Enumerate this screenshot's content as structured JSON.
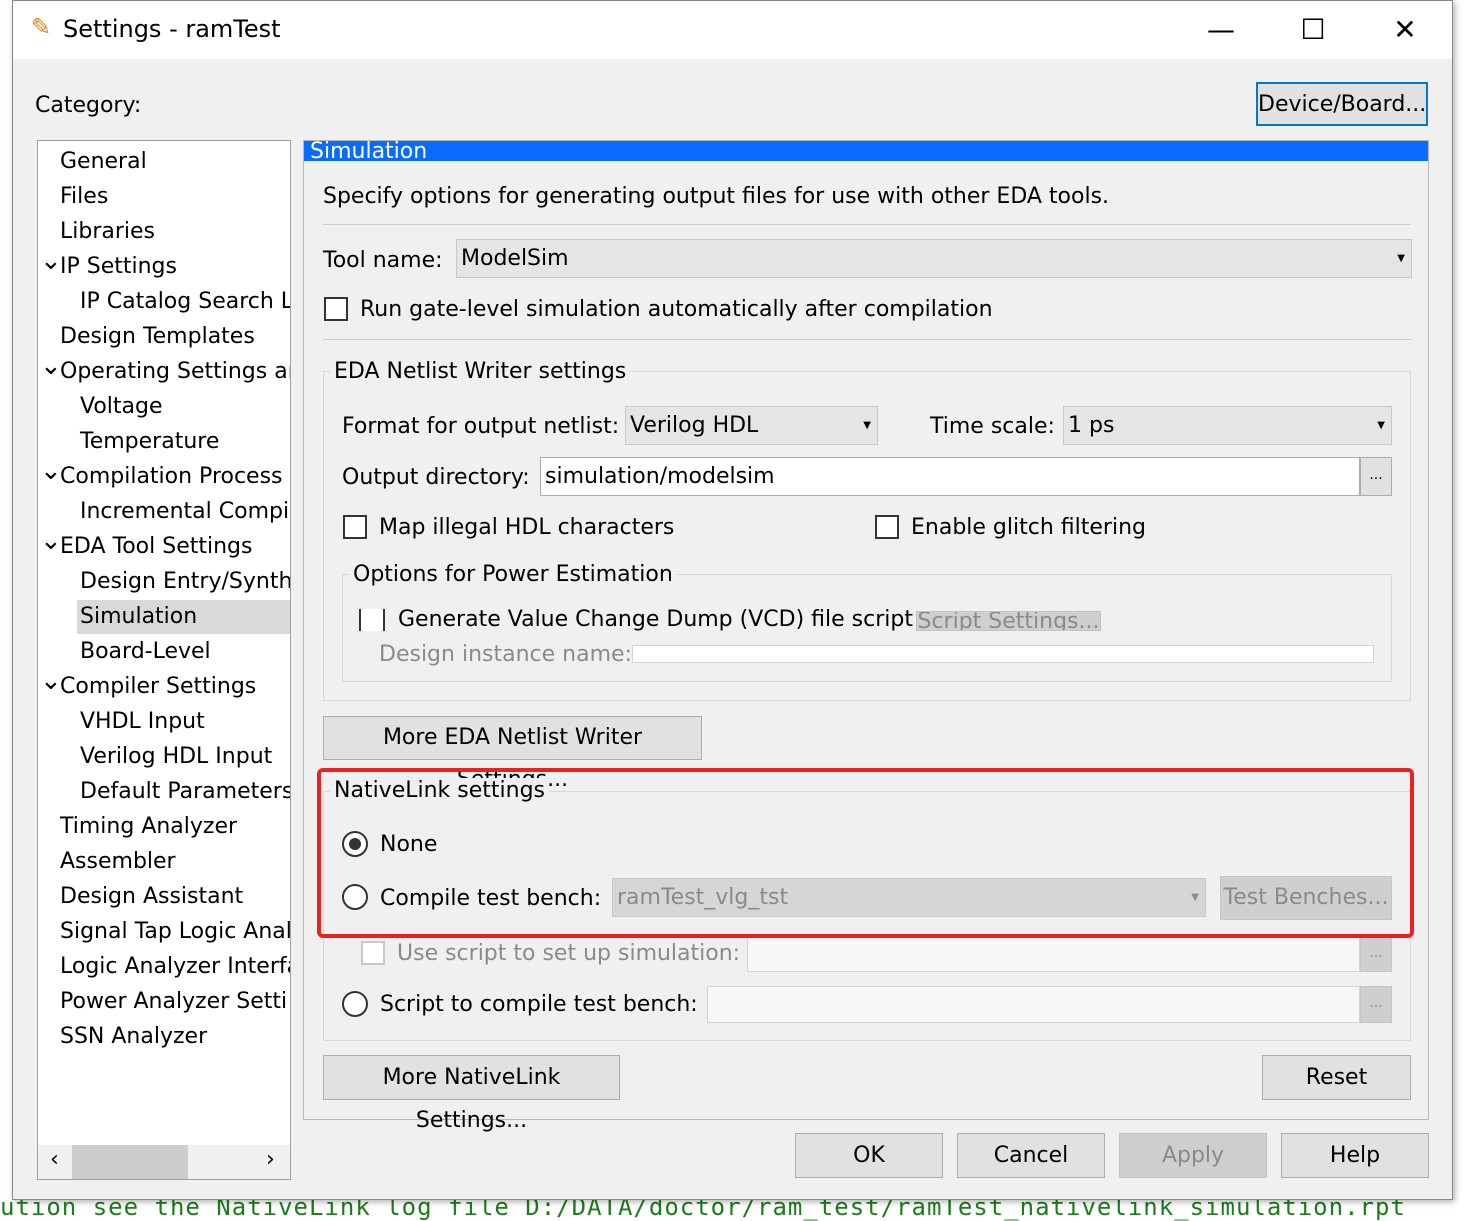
{
  "window": {
    "title": "Settings - ramTest",
    "minimize": "—",
    "maximize": "☐",
    "close": "✕"
  },
  "category_label": "Category:",
  "device_board_button": "Device/Board...",
  "tree": {
    "items": [
      {
        "label": "General",
        "level": 0
      },
      {
        "label": "Files",
        "level": 0
      },
      {
        "label": "Libraries",
        "level": 0
      },
      {
        "label": "IP Settings",
        "level": 0,
        "expanded": true
      },
      {
        "label": "IP Catalog Search L",
        "level": 1
      },
      {
        "label": "Design Templates",
        "level": 0
      },
      {
        "label": "Operating Settings ar",
        "level": 0,
        "expanded": true
      },
      {
        "label": "Voltage",
        "level": 1
      },
      {
        "label": "Temperature",
        "level": 1
      },
      {
        "label": "Compilation Process",
        "level": 0,
        "expanded": true
      },
      {
        "label": "Incremental Compil",
        "level": 1
      },
      {
        "label": "EDA Tool Settings",
        "level": 0,
        "expanded": true
      },
      {
        "label": "Design Entry/Synth",
        "level": 1
      },
      {
        "label": "Simulation",
        "level": 1,
        "selected": true
      },
      {
        "label": "Board-Level",
        "level": 1
      },
      {
        "label": "Compiler Settings",
        "level": 0,
        "expanded": true
      },
      {
        "label": "VHDL Input",
        "level": 1
      },
      {
        "label": "Verilog HDL Input",
        "level": 1
      },
      {
        "label": "Default Parameters",
        "level": 1
      },
      {
        "label": "Timing Analyzer",
        "level": 0
      },
      {
        "label": "Assembler",
        "level": 0
      },
      {
        "label": "Design Assistant",
        "level": 0
      },
      {
        "label": "Signal Tap Logic Anal",
        "level": 0
      },
      {
        "label": "Logic Analyzer Interfa",
        "level": 0
      },
      {
        "label": "Power Analyzer Setti",
        "level": 0
      },
      {
        "label": "SSN Analyzer",
        "level": 0
      }
    ],
    "scroll_left": "‹",
    "scroll_right": "›"
  },
  "panel": {
    "header": "Simulation",
    "header_color": "#0a6cff",
    "description": "Specify options for generating output files for use with other EDA tools.",
    "tool_name_label": "Tool name:",
    "tool_name_value": "ModelSim",
    "run_gate_level": "Run gate-level simulation automatically after compilation",
    "netlist_group": "EDA Netlist Writer settings",
    "format_label": "Format for output netlist:",
    "format_value": "Verilog HDL",
    "time_scale_label": "Time scale:",
    "time_scale_value": "1 ps",
    "output_dir_label": "Output directory:",
    "output_dir_value": "simulation/modelsim",
    "browse": "...",
    "map_illegal": "Map illegal HDL characters",
    "glitch": "Enable glitch filtering",
    "power_group": "Options for Power Estimation",
    "vcd": "Generate Value Change Dump (VCD) file script",
    "script_settings": "Script Settings...",
    "design_instance_label": "Design instance name:",
    "more_netlist": "More EDA Netlist Writer Settings...",
    "nativelink_group": "NativeLink settings",
    "highlight_color": "#e8231d",
    "none": "None",
    "compile_tb_label": "Compile test bench:",
    "compile_tb_value": "ramTest_vlg_tst",
    "test_benches": "Test Benches...",
    "use_script": "Use script to set up simulation:",
    "script_compile": "Script to compile test bench:",
    "more_nativelink": "More NativeLink Settings...",
    "reset": "Reset"
  },
  "footer": {
    "ok": "OK",
    "cancel": "Cancel",
    "apply": "Apply",
    "help": "Help"
  },
  "background_text": "ution see the NativeLink log file D:/DATA/doctor/ram_test/ramTest_nativelink_simulation.rpt"
}
